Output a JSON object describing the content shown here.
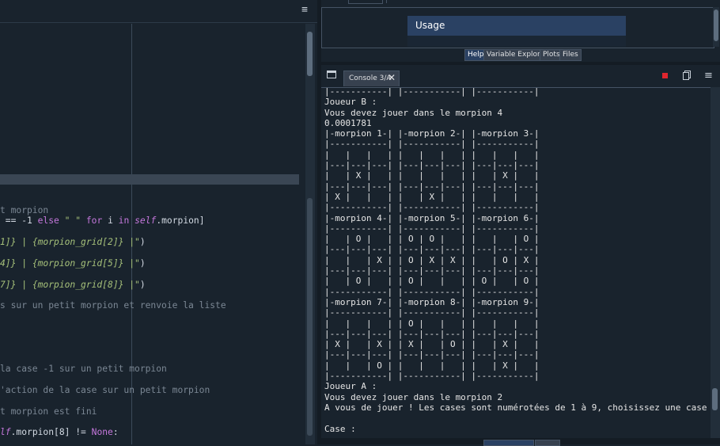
{
  "editor": {
    "lines": [
      {
        "segments": [
          {
            "t": "t morpion",
            "c": "cm"
          }
        ]
      },
      {
        "segments": [
          {
            "t": " == ",
            "c": "op"
          },
          {
            "t": "-1",
            "c": "op"
          },
          {
            "t": " else ",
            "c": "kw"
          },
          {
            "t": "\" \"",
            "c": "st"
          },
          {
            "t": " for ",
            "c": "kw"
          },
          {
            "t": "i",
            "c": "op"
          },
          {
            "t": " in ",
            "c": "kw"
          },
          {
            "t": "self",
            "c": "sf"
          },
          {
            "t": ".morpion]",
            "c": "op"
          }
        ]
      },
      {
        "segments": [
          {
            "t": "1]}",
            "c": "fs"
          },
          {
            "t": " | ",
            "c": "fs"
          },
          {
            "t": "{morpion_grid[2]}",
            "c": "fs"
          },
          {
            "t": " |\"",
            "c": "fs"
          },
          {
            "t": ")",
            "c": "op"
          }
        ]
      },
      {
        "segments": [
          {
            "t": "4]}",
            "c": "fs"
          },
          {
            "t": " | ",
            "c": "fs"
          },
          {
            "t": "{morpion_grid[5]}",
            "c": "fs"
          },
          {
            "t": " |\"",
            "c": "fs"
          },
          {
            "t": ")",
            "c": "op"
          }
        ]
      },
      {
        "segments": [
          {
            "t": "7]}",
            "c": "fs"
          },
          {
            "t": " | ",
            "c": "fs"
          },
          {
            "t": "{morpion_grid[8]}",
            "c": "fs"
          },
          {
            "t": " |\"",
            "c": "fs"
          },
          {
            "t": ")",
            "c": "op"
          }
        ]
      },
      {
        "segments": [
          {
            "t": "s sur un petit morpion et renvoie la liste",
            "c": "cm"
          }
        ]
      },
      {
        "segments": [
          {
            "t": "la case -1 sur un petit morpion",
            "c": "cm"
          }
        ]
      },
      {
        "segments": [
          {
            "t": "'action de la case sur un petit morpion",
            "c": "cm"
          }
        ]
      },
      {
        "segments": [
          {
            "t": "t morpion est fini",
            "c": "cm"
          }
        ]
      },
      {
        "segments": [
          {
            "t": "lf",
            "c": "sf"
          },
          {
            "t": ".morpion[8] != ",
            "c": "op"
          },
          {
            "t": "None",
            "c": "kw"
          },
          {
            "t": ":",
            "c": "op"
          }
        ]
      }
    ]
  },
  "help": {
    "title": "Usage",
    "tabs": [
      {
        "label": "Help",
        "active": true
      },
      {
        "label": "Variable Explorer",
        "active": false
      },
      {
        "label": "Plots",
        "active": false
      },
      {
        "label": "Files",
        "active": false
      }
    ]
  },
  "console": {
    "tab_label": "Console 3/A",
    "close_glyph": "✕",
    "menu_glyph": "≡",
    "output": "|-----------| |-----------| |-----------|\nJoueur B :\nVous devez jouer dans le morpion 4\n0.0001781\n|-morpion 1-| |-morpion 2-| |-morpion 3-|\n|-----------| |-----------| |-----------|\n|   |   |   | |   |   |   | |   |   |   |\n|---|---|---| |---|---|---| |---|---|---|\n|   | X |   | |   |   |   | |   | X |   |\n|---|---|---| |---|---|---| |---|---|---|\n| X |   |   | |   | X |   | |   |   |   |\n|-----------| |-----------| |-----------|\n|-morpion 4-| |-morpion 5-| |-morpion 6-|\n|-----------| |-----------| |-----------|\n|   | O |   | | O | O |   | |   |   | O |\n|---|---|---| |---|---|---| |---|---|---|\n|   |   | X | | O | X | X | |   | O | X |\n|---|---|---| |---|---|---| |---|---|---|\n|   | O |   | | O |   |   | | O |   | O |\n|-----------| |-----------| |-----------|\n|-morpion 7-| |-morpion 8-| |-morpion 9-|\n|-----------| |-----------| |-----------|\n|   |   |   | | O |   |   | |   |   |   |\n|---|---|---| |---|---|---| |---|---|---|\n| X |   | X | | X |   | O | |   | X |   |\n|---|---|---| |---|---|---| |---|---|---|\n|   |   | O | |   |   |   | |   | X |   |\n|-----------| |-----------| |-----------|\nJoueur A :\nVous devez jouer dans le morpion 2\nA vous de jouer ! Les cases sont numérotées de 1 à 9, choisissez une case vide\n\nCase : "
  },
  "editor_menu_glyph": "≡",
  "colors": {
    "background": "#19232d",
    "accent": "#2a4163",
    "stop": "#e0262e"
  }
}
